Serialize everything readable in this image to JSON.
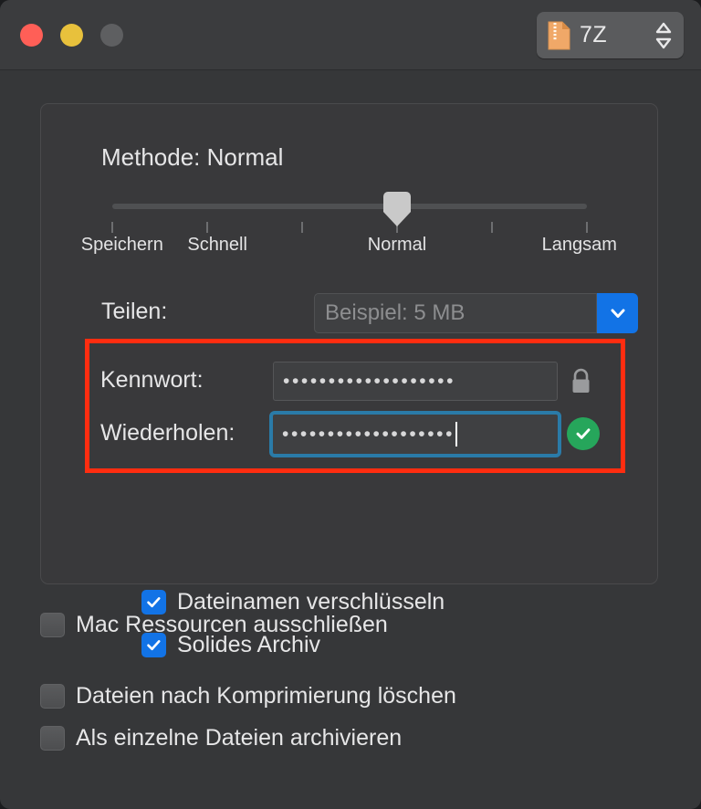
{
  "window": {
    "traffic_lights": [
      {
        "name": "close",
        "color": "#ff5f57"
      },
      {
        "name": "minimize",
        "color": "#e8c13c"
      },
      {
        "name": "zoom",
        "color": "#5e5f61"
      }
    ]
  },
  "format_popup": {
    "label": "7Z",
    "icon": "archive-file-icon",
    "stepper_icon": "up-down-stepper-icon"
  },
  "method": {
    "title": "Methode: Normal",
    "title_prefix": "Methode:",
    "selected": "Normal",
    "slider": {
      "tick_count": 6,
      "value_index": 3,
      "min_index": 0,
      "max_index": 5,
      "labels": [
        {
          "text": "Speichern",
          "index": 0
        },
        {
          "text": "Schnell",
          "index": 1
        },
        {
          "text": "Normal",
          "index": 3
        },
        {
          "text": "Langsam",
          "index": 5
        }
      ]
    }
  },
  "split": {
    "label": "Teilen:",
    "value": "",
    "placeholder": "Beispiel: 5 MB",
    "arrow_icon": "chevron-down-icon",
    "accent": "#1273e6"
  },
  "password": {
    "field1": {
      "label": "Kennwort:",
      "masked_value": "•••••••••••••••••••",
      "char_count": 19,
      "trailing_icon": "lock-icon"
    },
    "field2": {
      "label": "Wiederholen:",
      "masked_value": "•••••••••••••••••••",
      "char_count": 19,
      "focused": true,
      "trailing_icon": "check-circle-icon",
      "focus_color": "#2a7ba8",
      "valid_color": "#26a65b"
    },
    "annotation": {
      "type": "highlight-rect",
      "color": "#ff2d10"
    }
  },
  "panel_options": [
    {
      "label": "Dateinamen verschlüsseln",
      "checked": true,
      "name": "encrypt-filenames"
    },
    {
      "label": "Solides Archiv",
      "checked": true,
      "name": "solid-archive"
    }
  ],
  "bottom_options": [
    {
      "label": "Mac Ressourcen ausschließen",
      "checked": false,
      "name": "exclude-mac-resources"
    },
    {
      "label": "Dateien nach Komprimierung löschen",
      "checked": false,
      "name": "delete-after-compression"
    },
    {
      "label": "Als einzelne Dateien archivieren",
      "checked": false,
      "name": "archive-as-separate-files"
    }
  ]
}
